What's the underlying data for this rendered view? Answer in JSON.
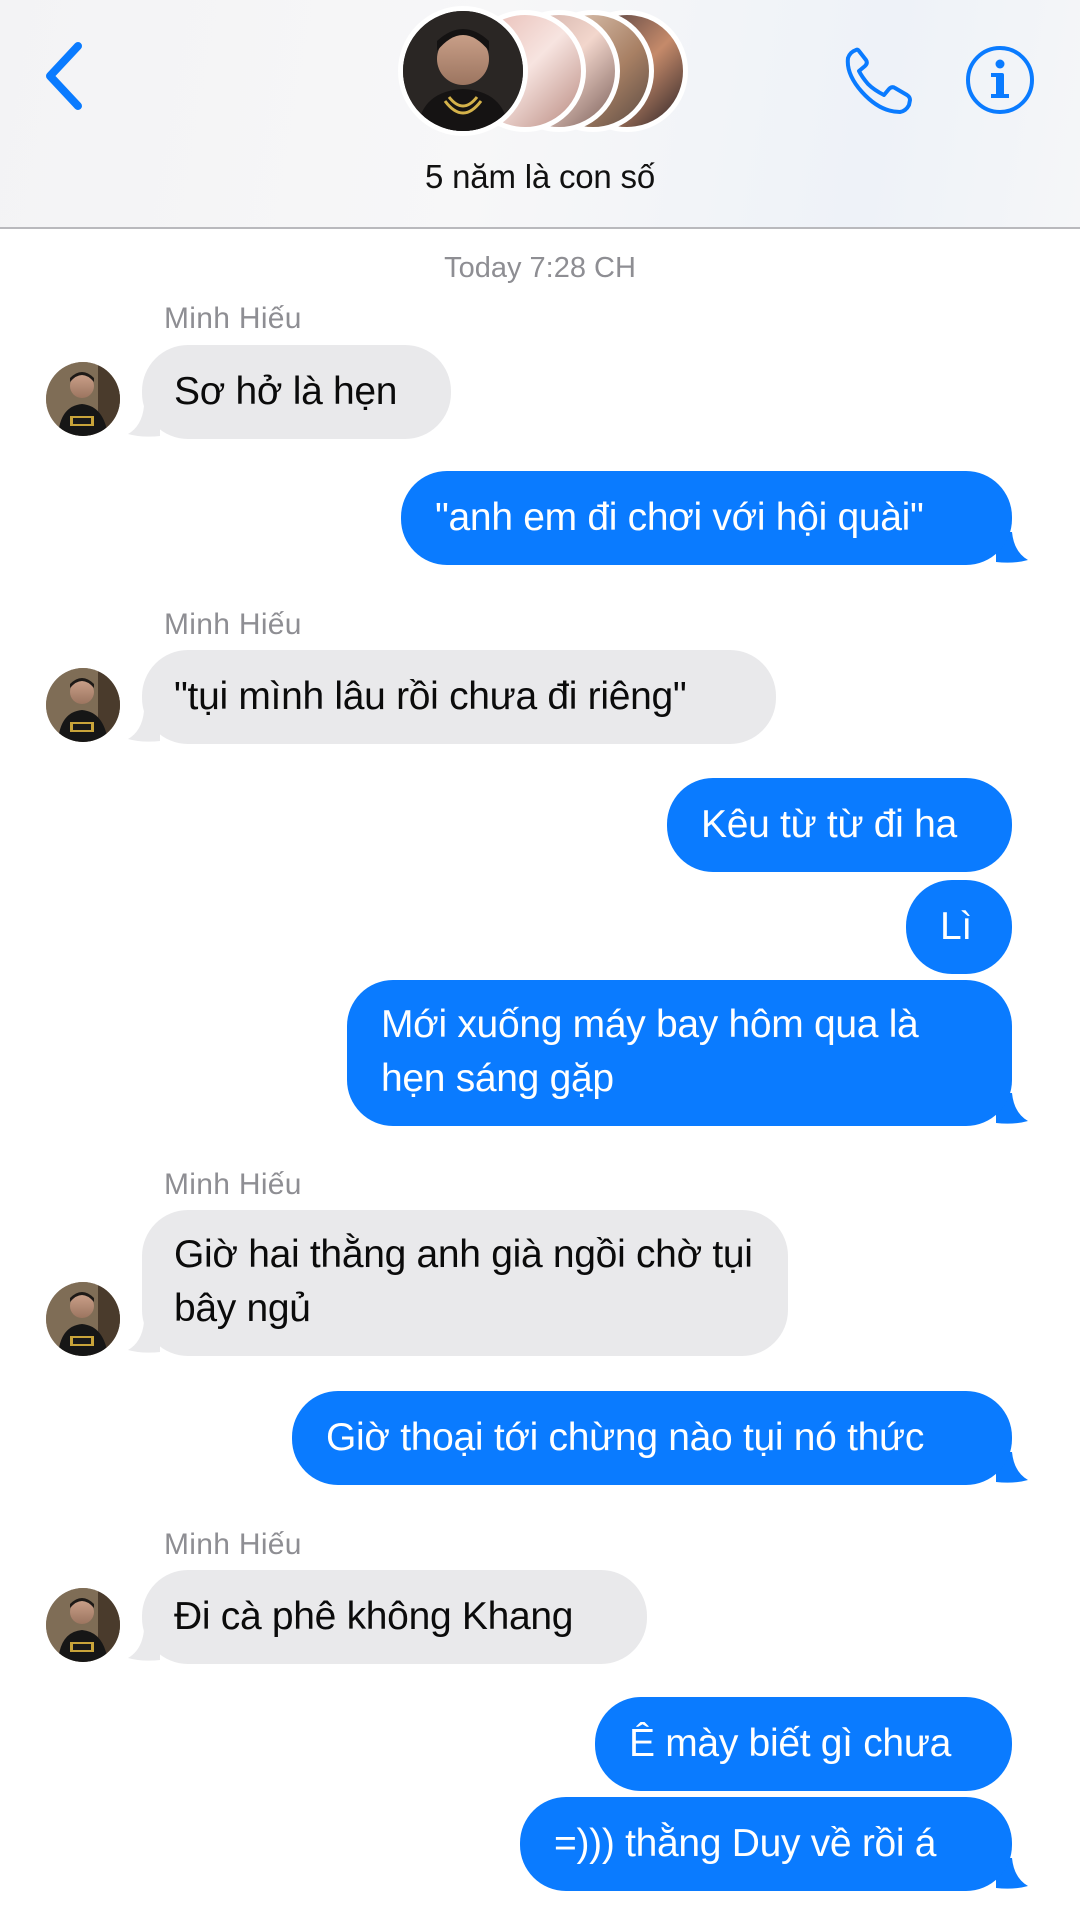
{
  "header": {
    "title": "5 năm là con số",
    "icons": {
      "back": "chevron-left-icon",
      "call": "phone-icon",
      "info": "info-icon"
    },
    "accent_color": "#0a7bff"
  },
  "chat": {
    "timestamp": "Today 7:28 CH",
    "sender_name": "Minh Hiếu",
    "colors": {
      "incoming_bubble": "#e9e9eb",
      "outgoing_bubble": "#0a7bff"
    },
    "messages": [
      {
        "from": "Minh Hiếu",
        "direction": "incoming",
        "text": "Sơ hở là hẹn"
      },
      {
        "from": "me",
        "direction": "outgoing",
        "text": "\"anh em đi chơi với hội quài\""
      },
      {
        "from": "Minh Hiếu",
        "direction": "incoming",
        "text": "\"tụi mình lâu rồi chưa đi riêng\""
      },
      {
        "from": "me",
        "direction": "outgoing",
        "text": "Kêu từ từ đi ha"
      },
      {
        "from": "me",
        "direction": "outgoing",
        "text": "Lì"
      },
      {
        "from": "me",
        "direction": "outgoing",
        "text": "Mới xuống máy bay hôm qua là hẹn sáng gặp"
      },
      {
        "from": "Minh Hiếu",
        "direction": "incoming",
        "text": "Giờ hai thằng anh già ngồi chờ tụi bây ngủ"
      },
      {
        "from": "me",
        "direction": "outgoing",
        "text": "Giờ thoại tới chừng nào tụi nó thức"
      },
      {
        "from": "Minh Hiếu",
        "direction": "incoming",
        "text": "Đi cà phê không Khang"
      },
      {
        "from": "me",
        "direction": "outgoing",
        "text": "Ê mày biết gì chưa"
      },
      {
        "from": "me",
        "direction": "outgoing",
        "text": "=))) thằng Duy về rồi á"
      }
    ]
  }
}
